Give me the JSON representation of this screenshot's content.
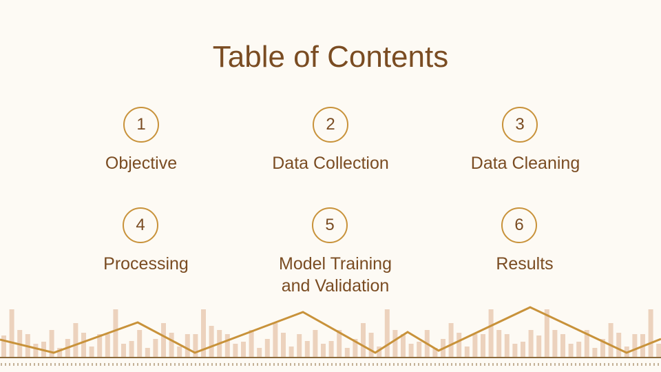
{
  "title": "Table of Contents",
  "items": [
    {
      "number": "1",
      "label": "Objective"
    },
    {
      "number": "2",
      "label": "Data Collection"
    },
    {
      "number": "3",
      "label": "Data Cleaning"
    },
    {
      "number": "4",
      "label": "Processing"
    },
    {
      "number": "5",
      "label": "Model Training\nand Validation"
    },
    {
      "number": "6",
      "label": "Results"
    }
  ],
  "colors": {
    "background": "#fdfaf4",
    "text": "#7a4c22",
    "accent": "#c8923a",
    "bars": "#ecd2bd",
    "baseline": "#8a6a3c"
  }
}
